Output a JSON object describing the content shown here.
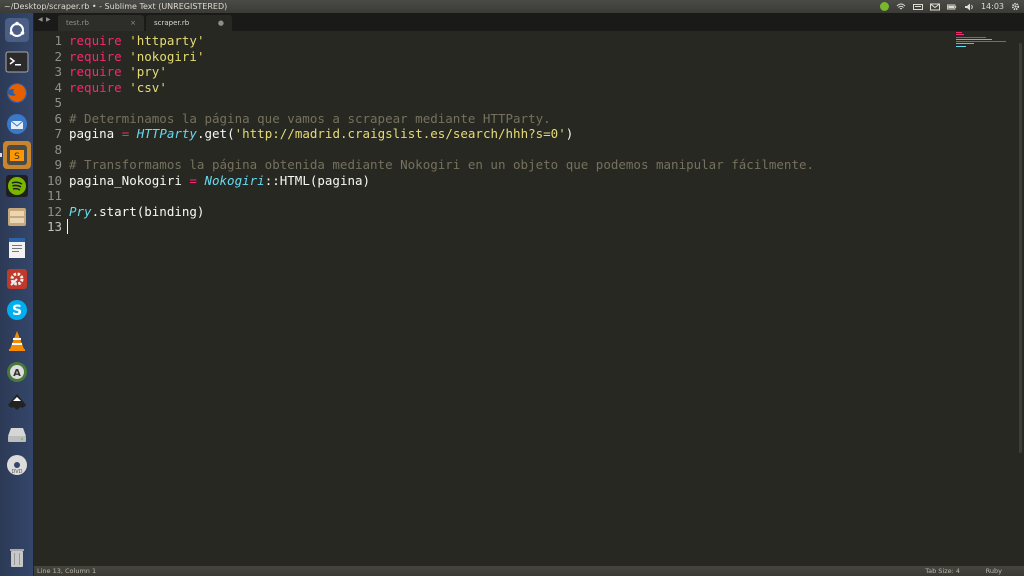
{
  "window": {
    "title": "~/Desktop/scraper.rb • - Sublime Text (UNREGISTERED)"
  },
  "panel": {
    "clock": "14:03",
    "tray_icons": [
      "spotify-icon",
      "wifi-icon",
      "keyboard-icon",
      "mail-icon",
      "battery-icon",
      "volume-icon",
      "settings-gear-icon"
    ]
  },
  "launcher": {
    "items": [
      "ubuntu-dash",
      "terminal",
      "firefox",
      "thunderbird",
      "sublime-text",
      "spotify",
      "files",
      "libreoffice-writer",
      "system-settings",
      "skype",
      "vlc",
      "software-center",
      "inkscape",
      "removable-drive",
      "dvd",
      "trash"
    ]
  },
  "tabs": [
    {
      "label": "test.rb",
      "close": "×",
      "active": false
    },
    {
      "label": "scraper.rb",
      "close": "●",
      "active": true
    }
  ],
  "editor": {
    "line_numbers": [
      "1",
      "2",
      "3",
      "4",
      "5",
      "6",
      "7",
      "8",
      "9",
      "10",
      "11",
      "12",
      "13"
    ],
    "current_line": 13,
    "lines": [
      [
        {
          "t": "require",
          "c": "kw"
        },
        {
          "t": " "
        },
        {
          "t": "'httparty'",
          "c": "str"
        }
      ],
      [
        {
          "t": "require",
          "c": "kw"
        },
        {
          "t": " "
        },
        {
          "t": "'nokogiri'",
          "c": "str"
        }
      ],
      [
        {
          "t": "require",
          "c": "kw"
        },
        {
          "t": " "
        },
        {
          "t": "'pry'",
          "c": "str"
        }
      ],
      [
        {
          "t": "require",
          "c": "kw"
        },
        {
          "t": " "
        },
        {
          "t": "'csv'",
          "c": "str"
        }
      ],
      [],
      [
        {
          "t": "# Determinamos la página que vamos a scrapear mediante HTTParty.",
          "c": "cmt"
        }
      ],
      [
        {
          "t": "pagina "
        },
        {
          "t": "=",
          "c": "kw"
        },
        {
          "t": " "
        },
        {
          "t": "HTTParty",
          "c": "cls"
        },
        {
          "t": ".get("
        },
        {
          "t": "'http://madrid.craigslist.es/search/hhh?s=0'",
          "c": "str"
        },
        {
          "t": ")"
        }
      ],
      [],
      [
        {
          "t": "# Transformamos la página obtenida mediante Nokogiri en un objeto que podemos manipular fácilmente.",
          "c": "cmt"
        }
      ],
      [
        {
          "t": "pagina_Nokogiri "
        },
        {
          "t": "=",
          "c": "kw"
        },
        {
          "t": " "
        },
        {
          "t": "Nokogiri",
          "c": "cls"
        },
        {
          "t": "::HTML(pagina)"
        }
      ],
      [],
      [
        {
          "t": "Pry",
          "c": "cls"
        },
        {
          "t": ".start(binding)"
        }
      ],
      []
    ]
  },
  "status_bar": {
    "position": "Line 13, Column 1",
    "tab_size": "Tab Size: 4",
    "syntax": "Ruby"
  },
  "colors": {
    "keyword": "#f92672",
    "string": "#e6db74",
    "comment": "#75715e",
    "class": "#66d9ef",
    "background": "#272822"
  }
}
